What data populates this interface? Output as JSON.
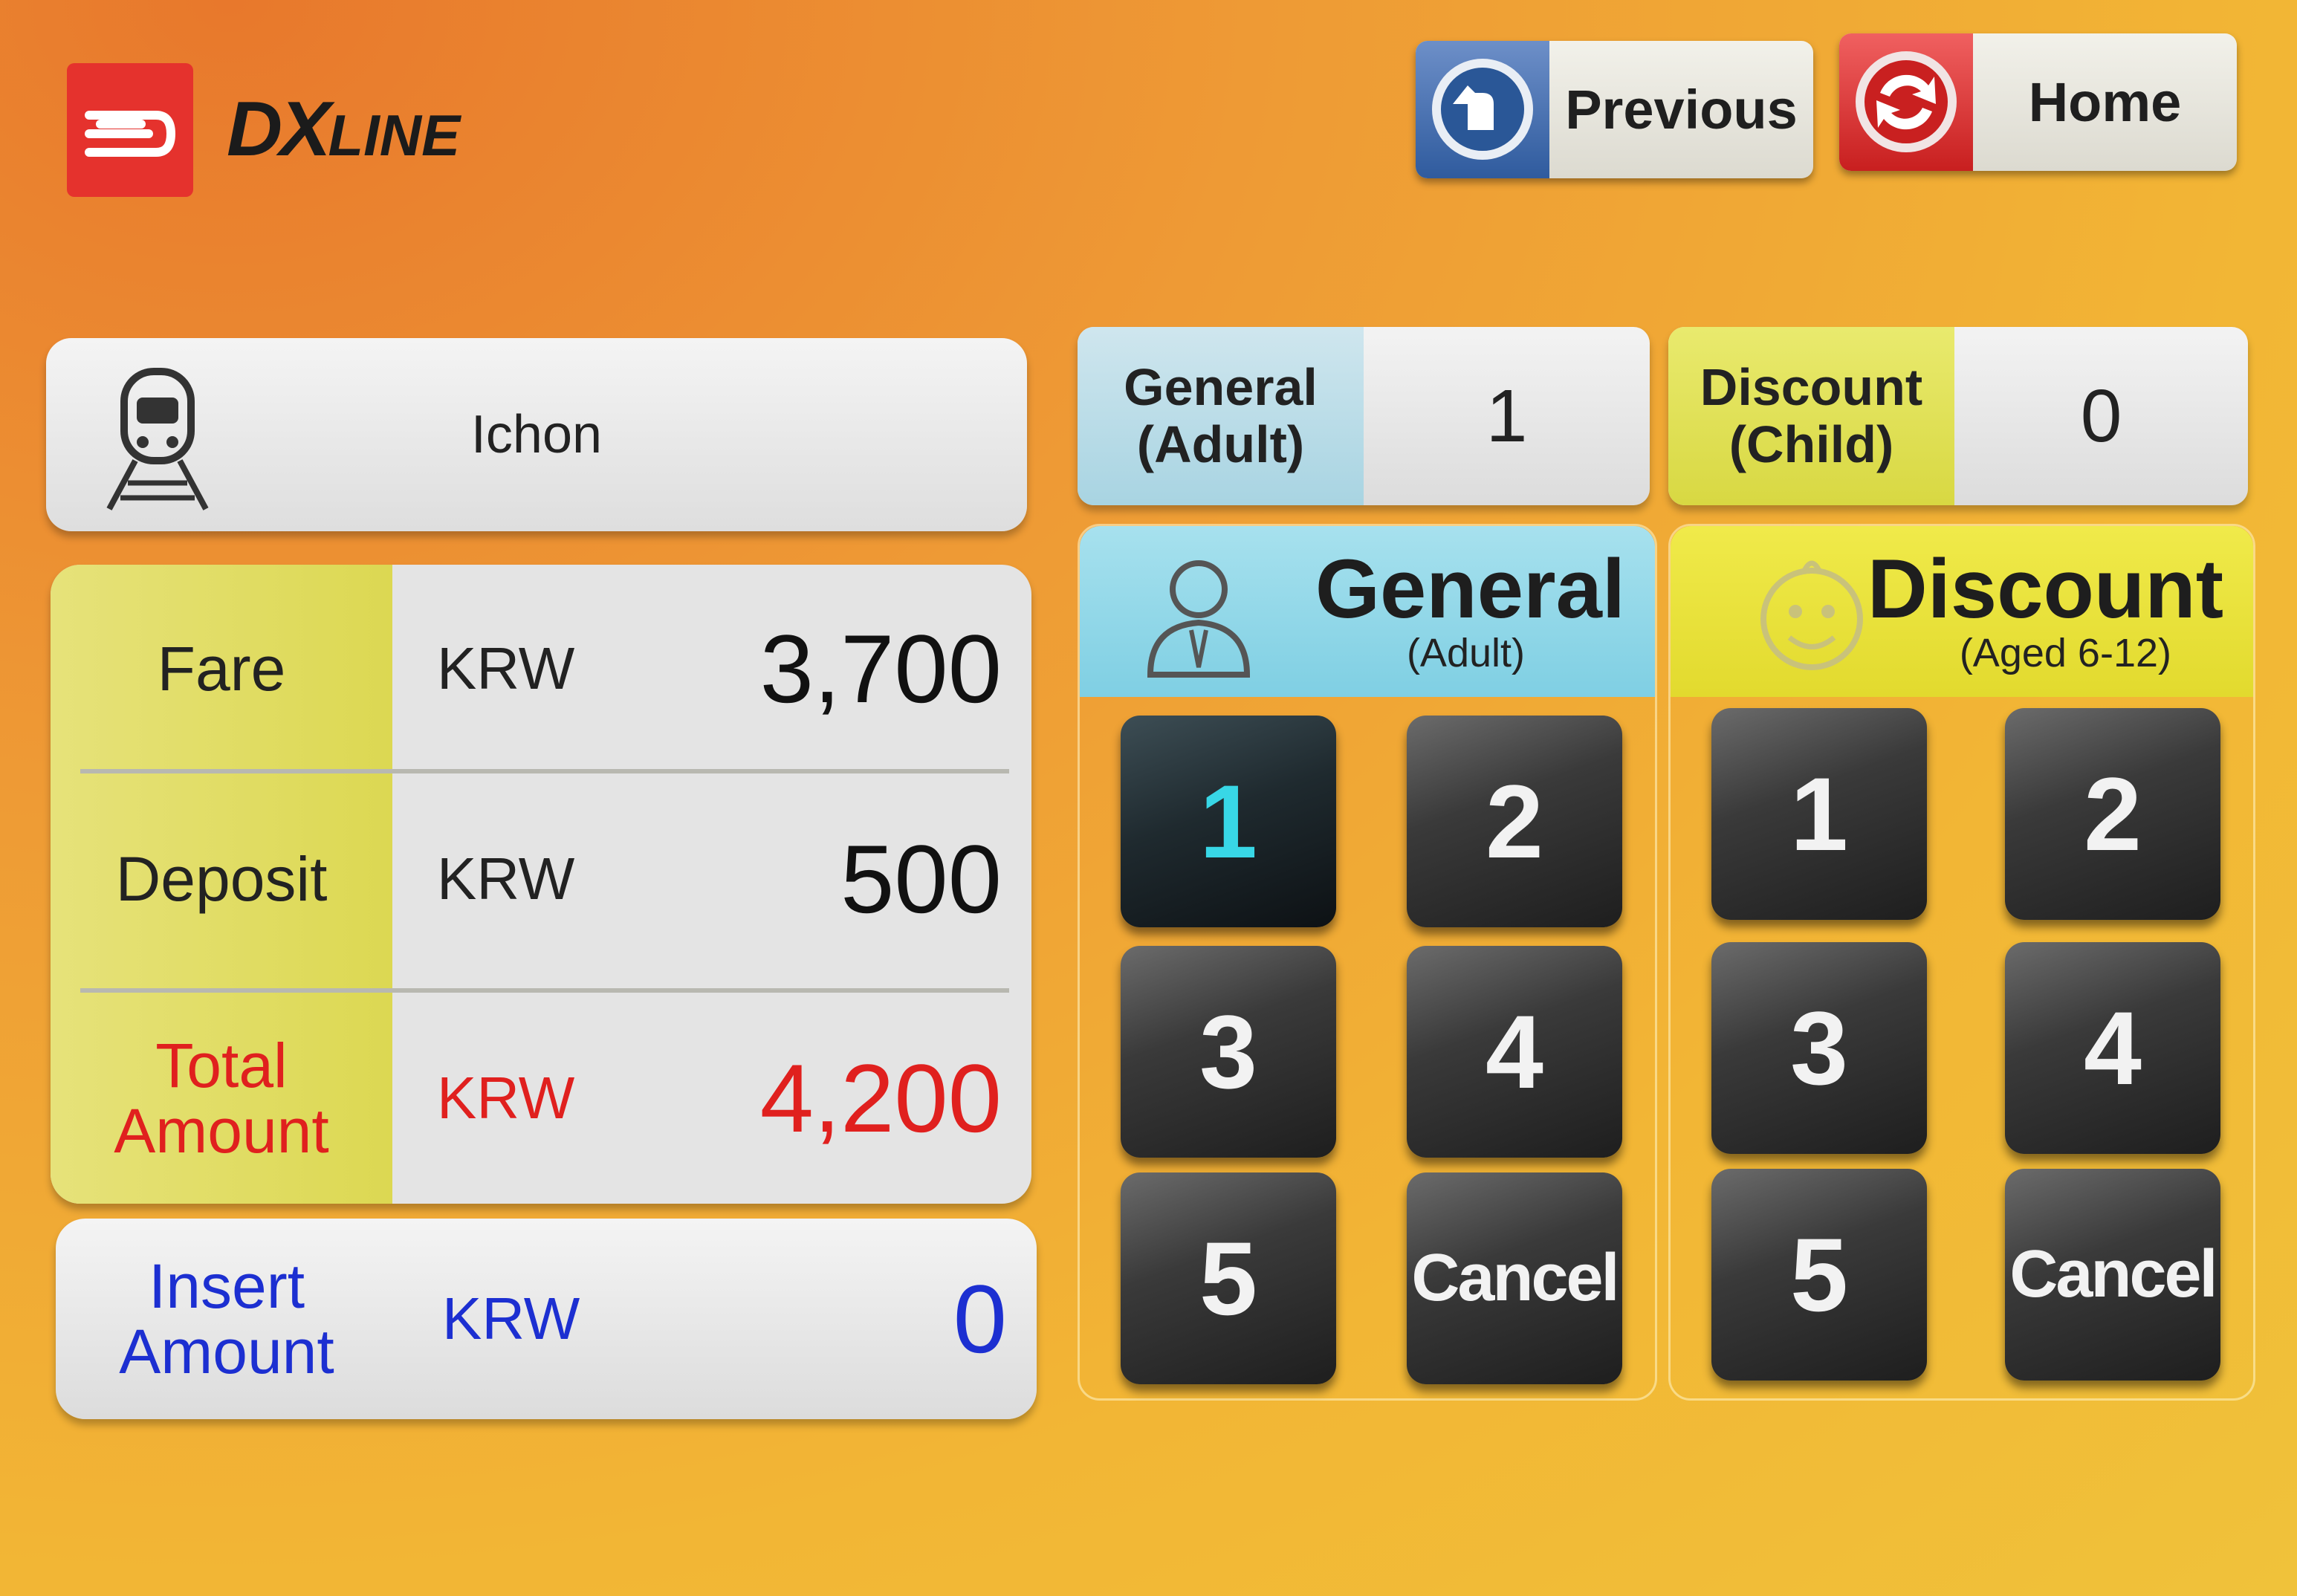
{
  "header": {
    "logo_text": "DX",
    "logo_sub": "LINE",
    "previous_label": "Previous",
    "home_label": "Home"
  },
  "destination": {
    "name": "Ichon"
  },
  "fare_table": {
    "rows": [
      {
        "label": "Fare",
        "currency": "KRW",
        "value": "3,700"
      },
      {
        "label": "Deposit",
        "currency": "KRW",
        "value": "500"
      },
      {
        "label_line1": "Total",
        "label_line2": "Amount",
        "currency": "KRW",
        "value": "4,200"
      }
    ],
    "insert": {
      "label_line1": "Insert",
      "label_line2": "Amount",
      "currency": "KRW",
      "value": "0"
    }
  },
  "counts": {
    "general": {
      "label_line1": "General",
      "label_line2": "(Adult)",
      "value": "1"
    },
    "discount": {
      "label_line1": "Discount",
      "label_line2": "(Child)",
      "value": "0"
    }
  },
  "general_pad": {
    "title": "General",
    "subtitle": "(Adult)",
    "keys": [
      "1",
      "2",
      "3",
      "4",
      "5",
      "Cancel"
    ]
  },
  "discount_pad": {
    "title": "Discount",
    "subtitle": "(Aged 6-12)",
    "keys": [
      "1",
      "2",
      "3",
      "4",
      "5",
      "Cancel"
    ]
  },
  "colors": {
    "total_red": "#e0201e",
    "insert_blue": "#1c2fd1",
    "active_key": "#38d7e6",
    "logo_red": "#e5322d"
  },
  "icons": [
    "logo-icon",
    "back-arrow-icon",
    "home-refresh-icon",
    "train-icon",
    "adult-person-icon",
    "child-face-icon"
  ]
}
